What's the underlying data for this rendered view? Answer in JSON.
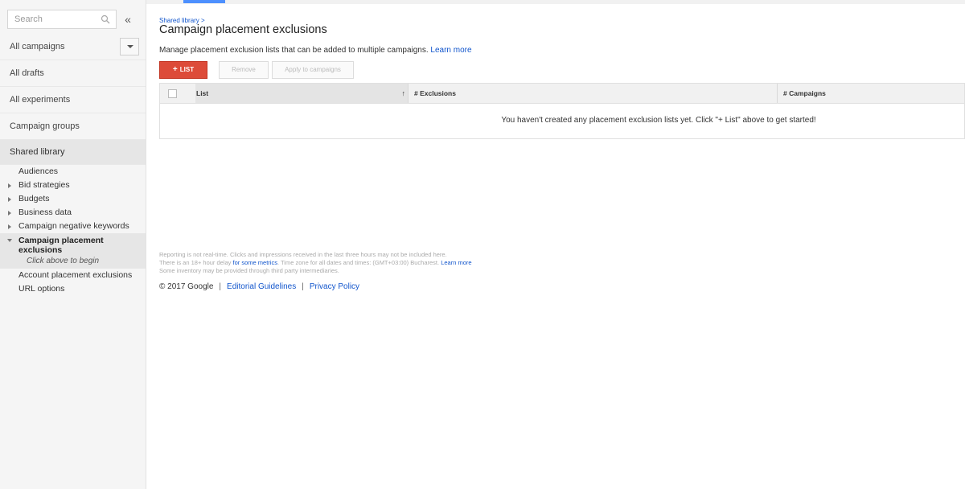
{
  "sidebar": {
    "search_placeholder": "Search",
    "collapse_glyph": "«",
    "nav": [
      {
        "label": "All campaigns"
      },
      {
        "label": "All drafts"
      },
      {
        "label": "All experiments"
      },
      {
        "label": "Campaign groups"
      },
      {
        "label": "Shared library"
      }
    ],
    "library": {
      "audiences": "Audiences",
      "bid_strategies": "Bid strategies",
      "budgets": "Budgets",
      "business_data": "Business data",
      "campaign_negative_keywords": "Campaign negative keywords",
      "campaign_placement_exclusions": "Campaign placement exclusions",
      "sub_hint": "Click above to begin",
      "account_placement_exclusions": "Account placement exclusions",
      "url_options": "URL options"
    }
  },
  "main": {
    "breadcrumb": "Shared library >",
    "title": "Campaign placement exclusions",
    "description": "Manage placement exclusion lists that can be added to multiple campaigns.",
    "learn_more": "Learn more",
    "buttons": {
      "add_plus": "+",
      "add_list": "LIST",
      "remove": "Remove",
      "apply": "Apply to campaigns"
    },
    "table": {
      "col_list": "List",
      "sort_glyph": "↑",
      "col_exclusions": "# Exclusions",
      "col_campaigns": "# Campaigns",
      "empty_message": "You haven't created any placement exclusion lists yet. Click \"+ List\" above to get started!"
    },
    "notes": {
      "line1": "Reporting is not real-time. Clicks and impressions received in the last three hours may not be included here.",
      "line2_a": "There is an 18+ hour delay",
      "line2_link": "for some metrics",
      "line2_b": ". Time zone for all dates and times: (GMT+03:00) Bucharest.",
      "line2_learn": "Learn more",
      "line3": "Some inventory may be provided through third party intermediaries."
    },
    "footer": {
      "copyright": "© 2017 Google",
      "separator": "|",
      "editorial": "Editorial Guidelines",
      "privacy": "Privacy Policy"
    }
  },
  "colors": {
    "accent_red": "#dd4b39",
    "link_blue": "#1155cc",
    "tab_blue": "#4d90fe"
  }
}
